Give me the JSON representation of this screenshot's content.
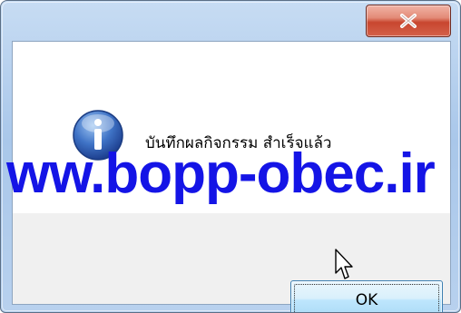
{
  "dialog": {
    "message": "บันทึกผลกิจกรรม สำเร็จแล้ว",
    "icon": "information-icon",
    "ok_label": "OK",
    "close_icon": "close-icon"
  },
  "watermark": {
    "text": "ww.bopp-obec.ir",
    "color": "#1414e6"
  },
  "colors": {
    "close_button": "#c8462f",
    "ok_button": "#a7d9f5",
    "title_bar": "#a9c7ea"
  }
}
